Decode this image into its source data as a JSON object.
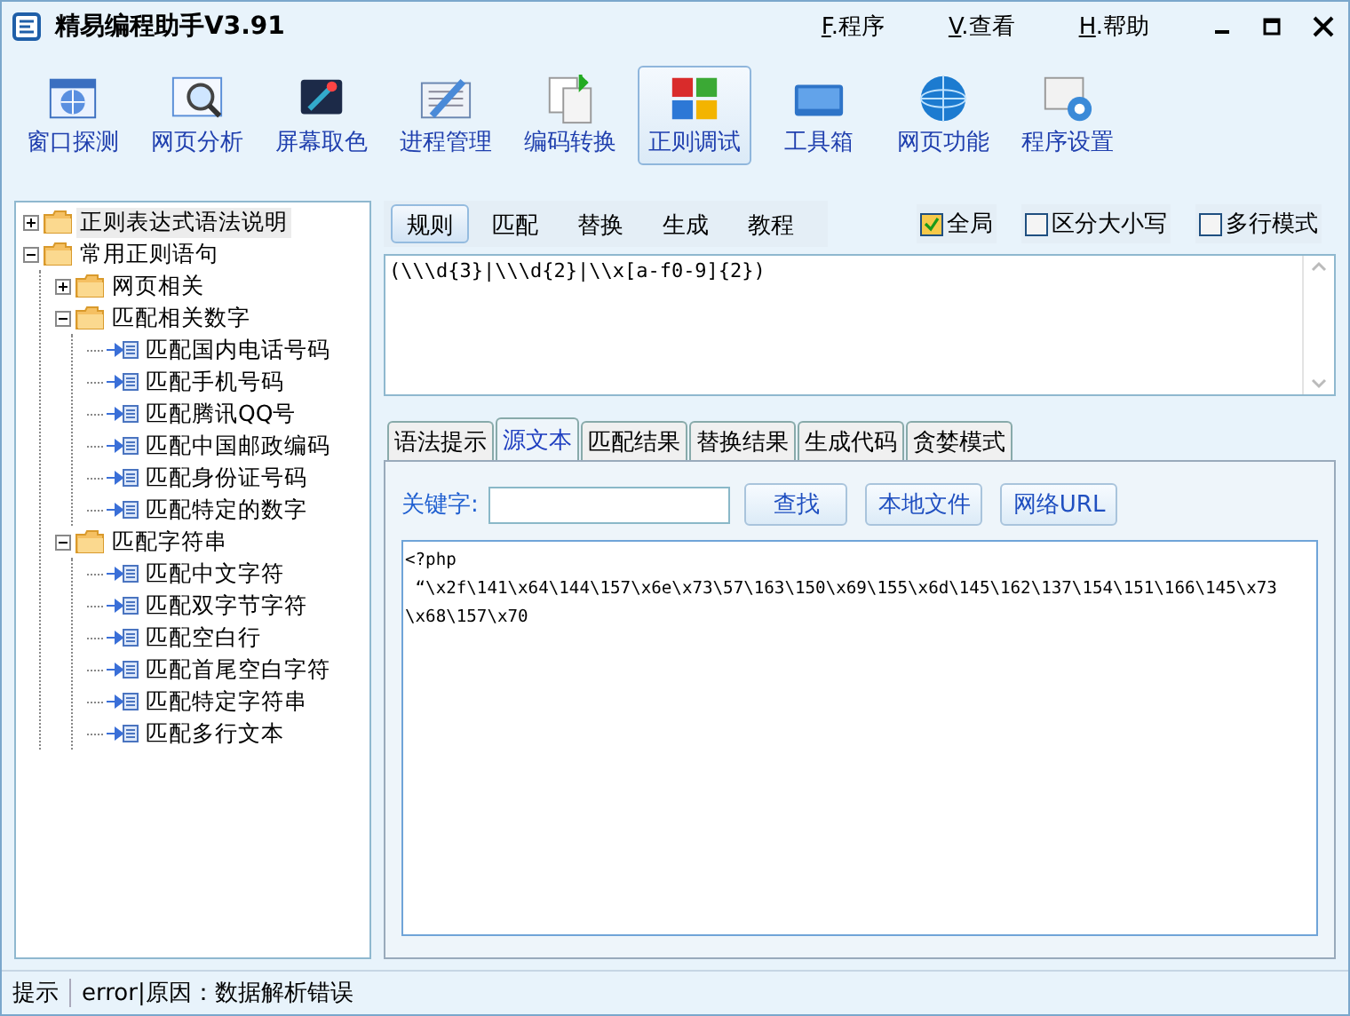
{
  "window": {
    "title": "精易编程助手V3.91"
  },
  "menu": [
    {
      "key": "F",
      "label": ".程序"
    },
    {
      "key": "V",
      "label": ".查看"
    },
    {
      "key": "H",
      "label": ".帮助"
    }
  ],
  "toolbar": [
    {
      "label": "窗口探测",
      "selected": false
    },
    {
      "label": "网页分析",
      "selected": false
    },
    {
      "label": "屏幕取色",
      "selected": false
    },
    {
      "label": "进程管理",
      "selected": false
    },
    {
      "label": "编码转换",
      "selected": false
    },
    {
      "label": "正则调试",
      "selected": true
    },
    {
      "label": "工具箱",
      "selected": false
    },
    {
      "label": "网页功能",
      "selected": false
    },
    {
      "label": "程序设置",
      "selected": false
    }
  ],
  "tree": [
    {
      "label": "正则表达式语法说明",
      "kind": "folder",
      "expanded": false,
      "selected": true
    },
    {
      "label": "常用正则语句",
      "kind": "folder",
      "expanded": true,
      "selected": false,
      "children": [
        {
          "label": "网页相关",
          "kind": "folder",
          "expanded": false,
          "selected": false
        },
        {
          "label": "匹配相关数字",
          "kind": "folder",
          "expanded": true,
          "selected": false,
          "children": [
            {
              "label": "匹配国内电话号码",
              "kind": "leaf",
              "selected": false
            },
            {
              "label": "匹配手机号码",
              "kind": "leaf",
              "selected": false
            },
            {
              "label": "匹配腾讯QQ号",
              "kind": "leaf",
              "selected": false
            },
            {
              "label": "匹配中国邮政编码",
              "kind": "leaf",
              "selected": false
            },
            {
              "label": "匹配身份证号码",
              "kind": "leaf",
              "selected": false
            },
            {
              "label": "匹配特定的数字",
              "kind": "leaf",
              "selected": false
            }
          ]
        },
        {
          "label": "匹配字符串",
          "kind": "folder",
          "expanded": true,
          "selected": false,
          "children": [
            {
              "label": "匹配中文字符",
              "kind": "leaf",
              "selected": false
            },
            {
              "label": "匹配双字节字符",
              "kind": "leaf",
              "selected": false
            },
            {
              "label": "匹配空白行",
              "kind": "leaf",
              "selected": false
            },
            {
              "label": "匹配首尾空白字符",
              "kind": "leaf",
              "selected": false
            },
            {
              "label": "匹配特定字符串",
              "kind": "leaf",
              "selected": false
            },
            {
              "label": "匹配多行文本",
              "kind": "leaf",
              "selected": false
            }
          ]
        }
      ]
    }
  ],
  "mode_tabs": [
    {
      "label": "规则",
      "selected": true
    },
    {
      "label": "匹配",
      "selected": false
    },
    {
      "label": "替换",
      "selected": false
    },
    {
      "label": "生成",
      "selected": false
    },
    {
      "label": "教程",
      "selected": false
    }
  ],
  "options": [
    {
      "label": "全局",
      "checked": true
    },
    {
      "label": "区分大小写",
      "checked": false
    },
    {
      "label": "多行模式",
      "checked": false
    }
  ],
  "regex": "(\\\\\\d{3}|\\\\\\d{2}|\\\\x[a-f0-9]{2})",
  "result_tabs": [
    {
      "label": "语法提示",
      "selected": false
    },
    {
      "label": "源文本",
      "selected": true
    },
    {
      "label": "匹配结果",
      "selected": false
    },
    {
      "label": "替换结果",
      "selected": false
    },
    {
      "label": "生成代码",
      "selected": false
    },
    {
      "label": "贪婪模式",
      "selected": false
    }
  ],
  "keyword": {
    "label": "关键字:"
  },
  "buttons": [
    "查找",
    "本地文件",
    "网络URL"
  ],
  "source_lines": [
    "<?php",
    " “\\x2f\\141\\x64\\144\\157\\x6e\\x73\\57\\163\\150\\x69\\155\\x6d\\145\\162\\137\\154\\151\\166\\145\\x73",
    "\\x68\\157\\x70"
  ],
  "status_bar": {
    "label": "提示",
    "message": "error|原因：数据解析错误"
  }
}
